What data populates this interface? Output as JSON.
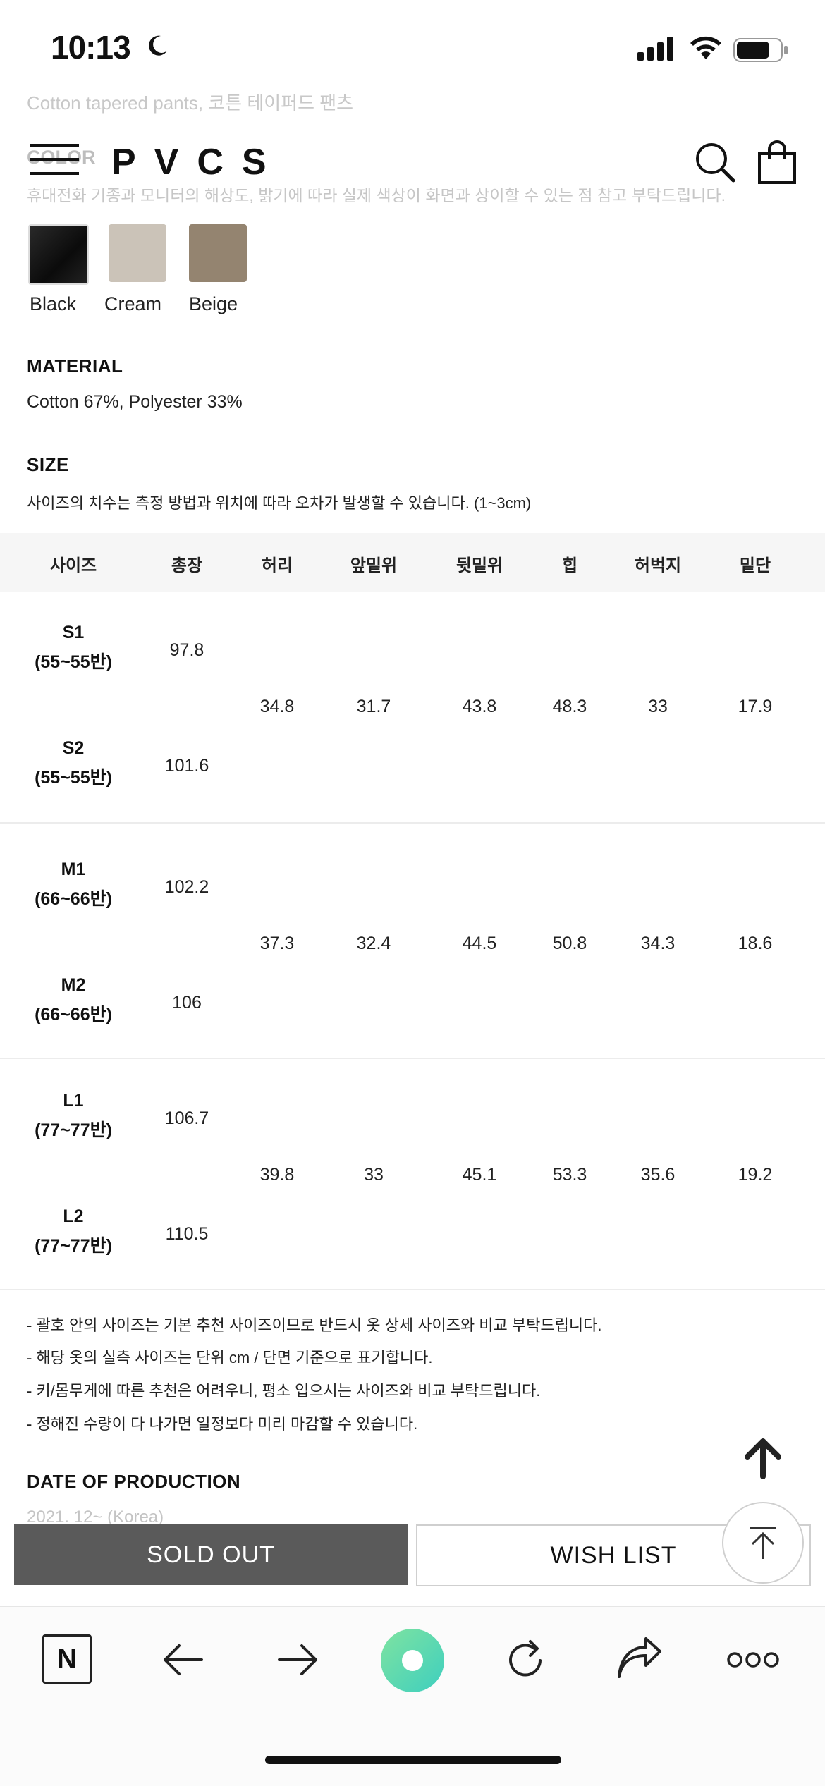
{
  "status_bar": {
    "time": "10:13"
  },
  "header": {
    "faded_product_name": "Cotton tapered pants, 코튼 테이퍼드 팬츠",
    "faded_color_title": "COLOR",
    "faded_color_note": "휴대전화 기종과 모니터의 해상도, 밝기에 따라 실제 색상이 화면과 상이할 수 있는 점 참고 부탁드립니다.",
    "logo": "PVCS"
  },
  "colors": {
    "items": [
      {
        "label": "Black",
        "hex": "#111111"
      },
      {
        "label": "Cream",
        "hex": "#cbc3b8"
      },
      {
        "label": "Beige",
        "hex": "#948470"
      }
    ]
  },
  "material": {
    "title": "MATERIAL",
    "value": "Cotton 67%, Polyester 33%"
  },
  "size": {
    "title": "SIZE",
    "note": "사이즈의 치수는 측정 방법과 위치에 따라 오차가 발생할 수 있습니다. (1~3cm)",
    "headers": [
      "사이즈",
      "총장",
      "허리",
      "앞밑위",
      "뒷밑위",
      "힙",
      "허벅지",
      "밑단"
    ],
    "groups": [
      {
        "sizes": [
          {
            "name": "S1",
            "range": "(55~55반)",
            "length": "97.8"
          },
          {
            "name": "S2",
            "range": "(55~55반)",
            "length": "101.6"
          }
        ],
        "waist": "34.8",
        "front_rise": "31.7",
        "back_rise": "43.8",
        "hip": "48.3",
        "thigh": "33",
        "hem": "17.9"
      },
      {
        "sizes": [
          {
            "name": "M1",
            "range": "(66~66반)",
            "length": "102.2"
          },
          {
            "name": "M2",
            "range": "(66~66반)",
            "length": "106"
          }
        ],
        "waist": "37.3",
        "front_rise": "32.4",
        "back_rise": "44.5",
        "hip": "50.8",
        "thigh": "34.3",
        "hem": "18.6"
      },
      {
        "sizes": [
          {
            "name": "L1",
            "range": "(77~77반)",
            "length": "106.7"
          },
          {
            "name": "L2",
            "range": "(77~77반)",
            "length": "110.5"
          }
        ],
        "waist": "39.8",
        "front_rise": "33",
        "back_rise": "45.1",
        "hip": "53.3",
        "thigh": "35.6",
        "hem": "19.2"
      }
    ],
    "notes": [
      "- 괄호 안의 사이즈는 기본 추천 사이즈이므로 반드시 옷 상세 사이즈와 비교 부탁드립니다.",
      "- 해당 옷의 실측 사이즈는 단위 cm / 단면 기준으로 표기합니다.",
      "- 키/몸무게에 따른 추천은 어려우니, 평소 입으시는 사이즈와 비교 부탁드립니다.",
      "- 정해진 수량이 다 나가면 일정보다 미리 마감할 수 있습니다."
    ]
  },
  "production": {
    "title": "DATE OF PRODUCTION",
    "value": "2021. 12~ (Korea)"
  },
  "buttons": {
    "sold_out": "SOLD OUT",
    "wish_list": "WISH LIST"
  },
  "browser_toolbar": {
    "items": [
      "naver-n-icon",
      "back-arrow-icon",
      "forward-arrow-icon",
      "green-dot-icon",
      "reload-icon",
      "share-icon",
      "more-icon"
    ],
    "home_label": "N",
    "accent": "#4fd7a0"
  }
}
